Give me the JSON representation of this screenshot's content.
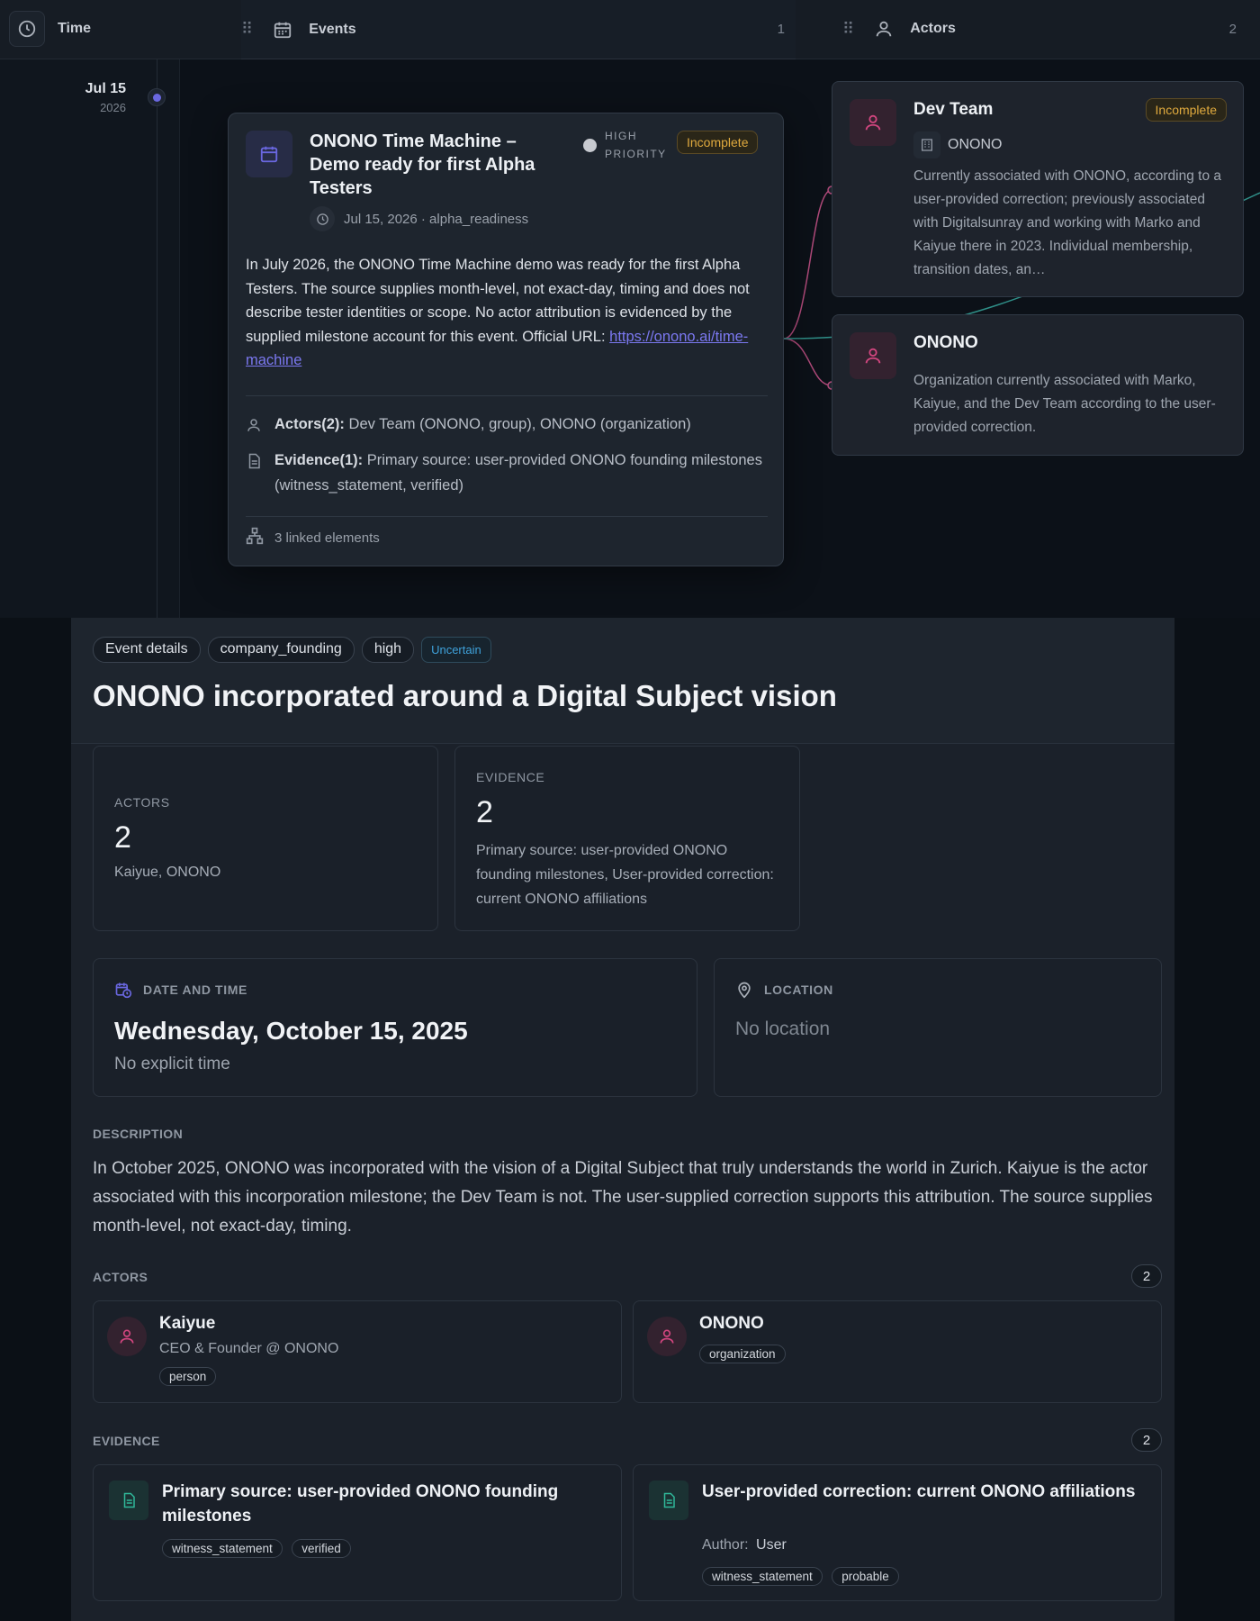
{
  "header": {
    "time_label": "Time",
    "events_label": "Events",
    "events_count": "1",
    "actors_label": "Actors",
    "actors_count": "2"
  },
  "timeline": {
    "date": "Jul 15",
    "year": "2026"
  },
  "event": {
    "title": "ONONO Time Machine – Demo ready for first Alpha Testers",
    "priority": "HIGH PRIORITY",
    "status": "Incomplete",
    "meta": "Jul 15, 2026 · alpha_readiness",
    "description": "In July 2026, the ONONO Time Machine demo was ready for the first Alpha Testers. The source supplies month-level, not exact-day, timing and does not describe tester identities or scope. No actor attribution is evidenced by the supplied milestone account for this event. Official URL: ",
    "url": "https://onono.ai/time-machine",
    "actors_label": "Actors(2):",
    "actors_value": " Dev Team (ONONO, group), ONONO (organization)",
    "evidence_label": "Evidence(1):",
    "evidence_value": " Primary source: user-provided ONONO founding milestones (witness_statement, verified)",
    "linked": "3 linked elements"
  },
  "actor_cards": [
    {
      "name": "Dev Team",
      "status": "Incomplete",
      "org": "ONONO",
      "description": "Currently associated with ONONO, according to a user-provided correction; previously associated with Digitalsunray and working with Marko and Kaiyue there in 2023. Individual membership, transition dates, an…"
    },
    {
      "name": "ONONO",
      "description": "Organization currently associated with Marko, Kaiyue, and the Dev Team according to the user-provided correction."
    }
  ],
  "detail": {
    "chips": [
      "Event details",
      "company_founding",
      "high",
      "Uncertain"
    ],
    "title": "ONONO incorporated around a Digital Subject vision",
    "actors_card": {
      "label": "ACTORS",
      "count": "2",
      "names": "Kaiyue, ONONO"
    },
    "evidence_card": {
      "label": "EVIDENCE",
      "count": "2",
      "text": "Primary source: user-provided ONONO founding milestones, User-provided correction: current ONONO affiliations"
    },
    "date_card": {
      "label": "DATE AND TIME",
      "date": "Wednesday, October 15, 2025",
      "time": "No explicit time"
    },
    "location_card": {
      "label": "LOCATION",
      "value": "No location"
    },
    "description_label": "DESCRIPTION",
    "description": "In October 2025, ONONO was incorporated with the vision of a Digital Subject that truly understands the world in Zurich. Kaiyue is the actor associated with this incorporation milestone; the Dev Team is not. The user-supplied correction supports this attribution. The source supplies month-level, not exact-day, timing.",
    "actors_section": {
      "label": "ACTORS",
      "count": "2",
      "items": [
        {
          "name": "Kaiyue",
          "role": "CEO & Founder @ ONONO",
          "tag": "person"
        },
        {
          "name": "ONONO",
          "tag": "organization"
        }
      ]
    },
    "evidence_section": {
      "label": "EVIDENCE",
      "count": "2",
      "items": [
        {
          "title": "Primary source: user-provided ONONO founding milestones",
          "tags": [
            "witness_statement",
            "verified"
          ]
        },
        {
          "title": "User-provided correction: current ONONO affiliations",
          "author_label": "Author:",
          "author": "User",
          "tags": [
            "witness_statement",
            "probable"
          ]
        }
      ]
    }
  },
  "colors": {
    "accent": "#6a67e0",
    "actor_pink": "#d2467f",
    "evidence_teal": "#2fb89a",
    "incomplete": "#e0aa3e",
    "uncertain": "#3fa2db"
  }
}
